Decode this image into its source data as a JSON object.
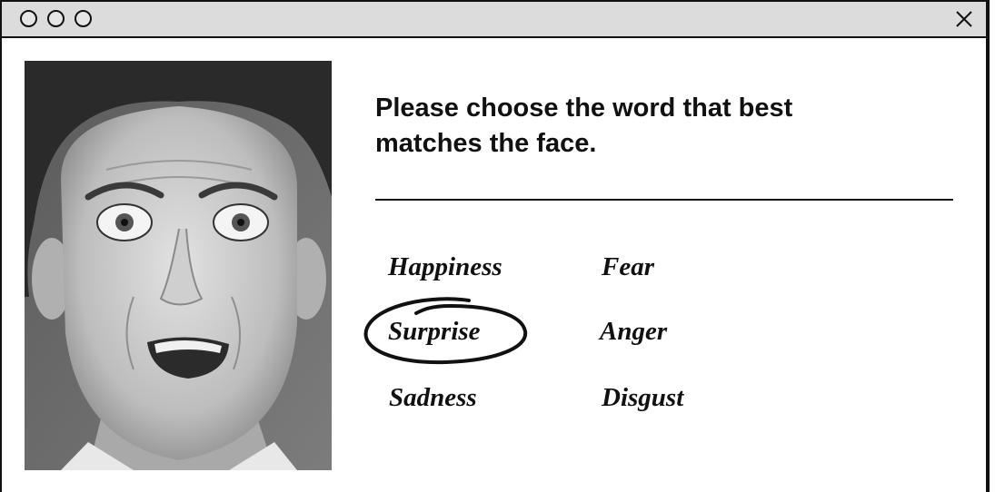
{
  "window": {
    "controls": [
      "circle-control-1",
      "circle-control-2",
      "circle-control-3"
    ],
    "close_icon": "close-icon"
  },
  "prompt": {
    "line1": "Please choose the word that best",
    "line2": "matches the face."
  },
  "options": [
    {
      "label": "Happiness",
      "selected": false
    },
    {
      "label": "Fear",
      "selected": false
    },
    {
      "label": "Surprise",
      "selected": true
    },
    {
      "label": "Anger",
      "selected": false
    },
    {
      "label": "Sadness",
      "selected": false
    },
    {
      "label": "Disgust",
      "selected": false
    }
  ],
  "colors": {
    "titlebar": "#dcdcdc",
    "ink": "#111111",
    "background": "#ffffff"
  }
}
